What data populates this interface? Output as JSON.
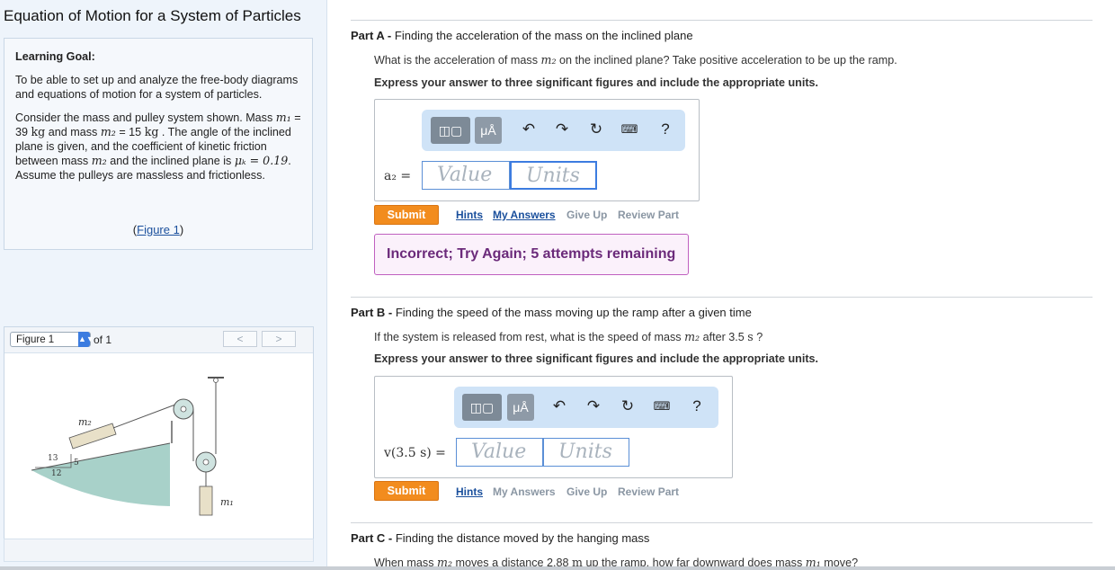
{
  "page_title": "Equation of Motion for a System of Particles",
  "learning_goal": {
    "heading": "Learning Goal:",
    "para1": "To be able to set up and analyze the free-body diagrams and equations of motion for a system of particles.",
    "para2": {
      "t1": "Consider the mass and pulley system shown. Mass ",
      "m1": "m₁",
      "t2": " = 39 ",
      "kg1": "kg",
      "t3": " and mass ",
      "m2": "m₂",
      "t4": " = 15 ",
      "kg2": "kg",
      "t5": " . The angle of the inclined plane is given, and the coefficient of kinetic friction between mass ",
      "m2b": "m₂",
      "t6": " and the inclined plane is ",
      "mu": "μₖ = 0.19",
      "t7": ". Assume the pulleys are massless and frictionless."
    },
    "figure_link_open": "(",
    "figure_link": "Figure 1",
    "figure_link_close": ")"
  },
  "figure_panel": {
    "select_value": "Figure 1",
    "of_label": "of 1",
    "prev": "<",
    "next": ">",
    "diagram": {
      "m2": "m₂",
      "m1": "m₁",
      "tri_hyp": "13",
      "tri_opp": "5",
      "tri_adj": "12"
    }
  },
  "part_a": {
    "prefix": "Part A - ",
    "title": "Finding the acceleration of the mass on the inclined plane",
    "q1": "What is the acceleration of mass ",
    "q_m": "m₂",
    "q2": " on the inclined plane? Take positive acceleration to be up the ramp.",
    "instruction": "Express your answer to three significant figures and include the appropriate units.",
    "label": "a₂ =",
    "value_placeholder": "Value",
    "units_placeholder": "Units",
    "submit": "Submit",
    "links": [
      "Hints",
      "My Answers",
      "Give Up",
      "Review Part"
    ],
    "feedback": "Incorrect; Try Again; 5 attempts remaining"
  },
  "part_b": {
    "prefix": "Part B - ",
    "title": "Finding the speed of the mass moving up the ramp after a given time",
    "q1": "If the system is released from rest, what is the speed of mass ",
    "q_m": "m₂",
    "q2": " after 3.5 ",
    "q_unit": "s",
    "q3": " ?",
    "instruction": "Express your answer to three significant figures and include the appropriate units.",
    "label": "v(3.5 s) =",
    "value_placeholder": "Value",
    "units_placeholder": "Units",
    "submit": "Submit",
    "links": [
      "Hints",
      "My Answers",
      "Give Up",
      "Review Part"
    ]
  },
  "part_c": {
    "prefix": "Part C - ",
    "title": "Finding the distance moved by the hanging mass",
    "q1": "When mass ",
    "q_m": "m₂",
    "q2": " moves a distance 2.88 ",
    "q_unit": "m",
    "q3": " up the ramp, how far downward does mass ",
    "q_m1": "m₁",
    "q4": " move?"
  },
  "toolbar": {
    "units_btn": "μÅ",
    "help": "?",
    "icons": [
      "template-icon",
      "units-icon",
      "undo-icon",
      "redo-icon",
      "reset-icon",
      "keyboard-icon",
      "help-icon"
    ]
  },
  "colors": {
    "accent": "#3c7ce0",
    "submit": "#f28c1e",
    "feedback": "#6b2a7a",
    "toolbar": "#cfe3f7"
  }
}
